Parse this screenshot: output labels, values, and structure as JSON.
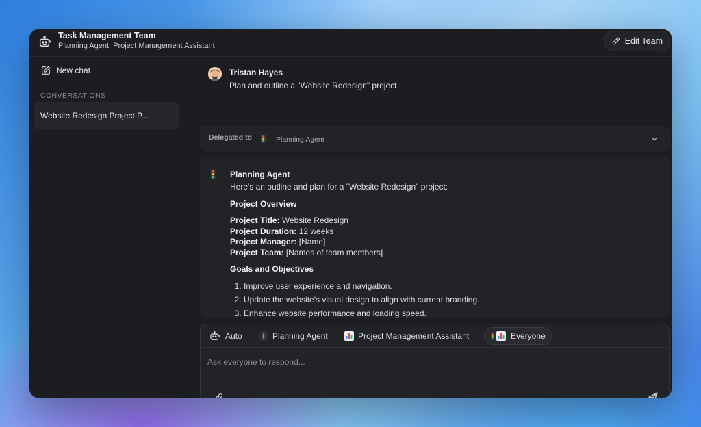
{
  "header": {
    "title": "Task Management Team",
    "subtitle": "Planning Agent, Project Management Assistant",
    "edit_label": "Edit Team"
  },
  "sidebar": {
    "new_chat_label": "New chat",
    "conversations_header": "CONVERSATIONS",
    "conversations": [
      {
        "label": "Website Redesign Project P..."
      }
    ]
  },
  "chat": {
    "user": {
      "name": "Tristan Hayes",
      "message": "Plan and outline a \"Website Redesign\" project."
    },
    "delegation": {
      "label": "Delegated to",
      "agent": "Planning Agent"
    },
    "agent_reply": {
      "name": "Planning Agent",
      "intro": "Here's an outline and plan for a \"Website Redesign\" project:",
      "overview_heading": "Project Overview",
      "fields": [
        {
          "label": "Project Title:",
          "value": "Website Redesign"
        },
        {
          "label": "Project Duration:",
          "value": "12 weeks"
        },
        {
          "label": "Project Manager:",
          "value": "[Name]"
        },
        {
          "label": "Project Team:",
          "value": "[Names of team members]"
        }
      ],
      "goals_heading": "Goals and Objectives",
      "goals": [
        "Improve user experience and navigation.",
        "Update the website's visual design to align with current branding.",
        "Enhance website performance and loading speed."
      ]
    }
  },
  "composer": {
    "targets": [
      {
        "label": "Auto",
        "icon": "robot-icon"
      },
      {
        "label": "Planning Agent",
        "icon": "traffic-light-icon"
      },
      {
        "label": "Project Management Assistant",
        "icon": "bar-chart-icon"
      },
      {
        "label": "Everyone",
        "icon": "group-icon",
        "selected": true
      }
    ],
    "placeholder": "Ask everyone to respond..."
  },
  "colors": {
    "window_bg": "#1c1d20",
    "card_bg": "#222327",
    "traffic_red": "#e74c3c",
    "traffic_yellow": "#f1c40f",
    "traffic_green": "#2ecc71",
    "chart_blue": "#3d8bfd"
  }
}
